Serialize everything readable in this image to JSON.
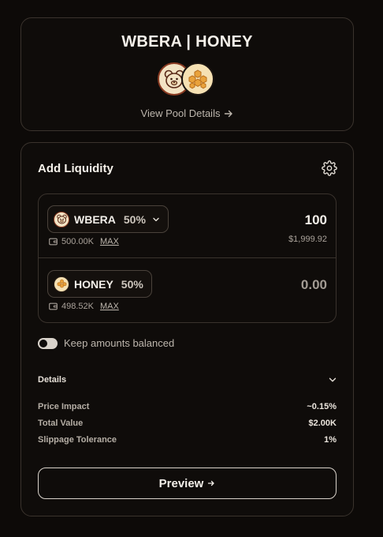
{
  "pool": {
    "title": "WBERA | HONEY",
    "view_details_label": "View Pool Details"
  },
  "liquidity": {
    "title": "Add Liquidity",
    "tokens": [
      {
        "symbol": "WBERA",
        "weight": "50%",
        "balance": "500.00K",
        "max_label": "MAX",
        "amount": "100",
        "usd_value": "$1,999.92",
        "icon": "bear-icon"
      },
      {
        "symbol": "HONEY",
        "weight": "50%",
        "balance": "498.52K",
        "max_label": "MAX",
        "amount": "0.00",
        "icon": "honeycomb-icon"
      }
    ],
    "keep_balanced_label": "Keep amounts balanced",
    "keep_balanced_on": false
  },
  "details": {
    "title": "Details",
    "rows": [
      {
        "label": "Price Impact",
        "value": "~0.15%"
      },
      {
        "label": "Total Value",
        "value": "$2.00K"
      },
      {
        "label": "Slippage Tolerance",
        "value": "1%"
      }
    ]
  },
  "preview_label": "Preview",
  "colors": {
    "background": "#0d0a08",
    "border": "#3a332d",
    "bera_brand": "#8a3b22",
    "honey_brand": "#e9a23b"
  }
}
